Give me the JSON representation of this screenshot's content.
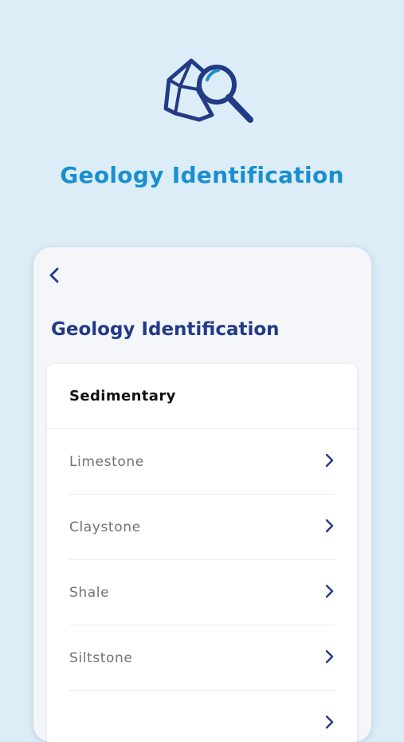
{
  "hero": {
    "title": "Geology Identification",
    "icon": "rock-magnifier-icon"
  },
  "screen": {
    "back_icon": "chevron-left-icon",
    "title": "Geology Identification"
  },
  "category": {
    "title": "Sedimentary",
    "items": [
      {
        "label": "Limestone"
      },
      {
        "label": "Claystone"
      },
      {
        "label": "Shale"
      },
      {
        "label": "Siltstone"
      },
      {
        "label": ""
      }
    ]
  },
  "colors": {
    "background": "#dcedf8",
    "accent": "#1a8fd0",
    "navy": "#233a86"
  }
}
